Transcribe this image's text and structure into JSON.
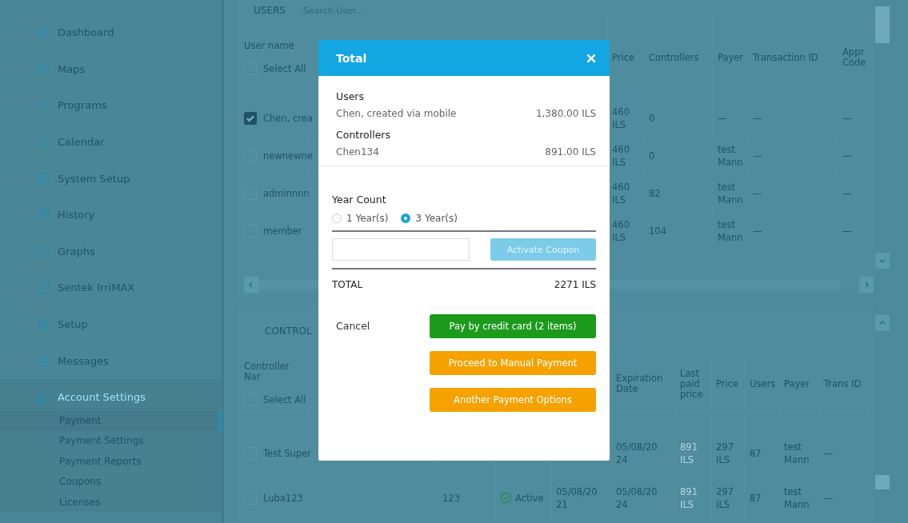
{
  "sidebar": {
    "items": [
      {
        "label": "Dashboard",
        "selected": false
      },
      {
        "label": "Maps",
        "selected": false
      },
      {
        "label": "Programs",
        "selected": false
      },
      {
        "label": "Calendar",
        "selected": false
      },
      {
        "label": "System Setup",
        "selected": false
      },
      {
        "label": "History",
        "selected": false
      },
      {
        "label": "Graphs",
        "selected": false
      },
      {
        "label": "Sentek IrriMAX",
        "selected": false
      },
      {
        "label": "Setup",
        "selected": false
      },
      {
        "label": "Messages",
        "selected": false
      },
      {
        "label": "Account Settings",
        "selected": true,
        "children": [
          {
            "label": "Payment",
            "selected": true
          },
          {
            "label": "Payment Settings",
            "selected": false
          },
          {
            "label": "Payment Reports",
            "selected": false
          },
          {
            "label": "Coupons",
            "selected": false
          },
          {
            "label": "Licenses",
            "selected": false
          }
        ]
      }
    ]
  },
  "users_section": {
    "title": "USERS",
    "search": {
      "placeholder": "Search User..."
    },
    "columns": {
      "name": "User name",
      "price": "Price",
      "controllers": "Controllers",
      "payer": "Payer",
      "transaction_id": "Transaction ID",
      "appr_code": "Appr Code"
    },
    "select_all": {
      "label": "Select All",
      "checked": false
    },
    "rows": [
      {
        "name": "Chen, crea",
        "checked": true,
        "price": "460 ILS",
        "controllers": "0",
        "payer": "—",
        "transaction_id": "—",
        "appr_code": "—"
      },
      {
        "name": "newnewne",
        "checked": false,
        "price": "460 ILS",
        "controllers": "0",
        "payer": "test Mann",
        "transaction_id": "—",
        "appr_code": "—"
      },
      {
        "name": "adminnnn",
        "checked": false,
        "price": "460 ILS",
        "controllers": "82",
        "payer": "test Mann",
        "transaction_id": "—",
        "appr_code": "—"
      },
      {
        "name": "member",
        "checked": false,
        "price": "460 ILS",
        "controllers": "104",
        "payer": "test Mann",
        "transaction_id": "—",
        "appr_code": "—"
      }
    ]
  },
  "controllers_section": {
    "title": "CONTROL",
    "columns": {
      "name": "Controller Nar",
      "expiration": "Expiration Date",
      "last_paid": "Last paid price",
      "price": "Price",
      "users": "Users",
      "payer": "Payer",
      "transaction_id": "Trans ID"
    },
    "select_all": {
      "label": "Select All",
      "checked": false
    },
    "rows": [
      {
        "name": "Test Super",
        "checked": false,
        "expiration": "05/08/2024",
        "last_paid": "891 ILS",
        "price": "297 ILS",
        "users": "87",
        "payer": "test Mann",
        "transaction_id": "—"
      },
      {
        "name": "Luba123",
        "checked": false,
        "column_3": "123",
        "status": "Active",
        "column_5": "05/08/2021",
        "expiration": "05/08/2024",
        "last_paid": "891 ILS",
        "price": "297 ILS",
        "users": "87",
        "payer": "test Mann",
        "transaction_id": "—"
      }
    ]
  },
  "dialog": {
    "title": "Total",
    "groups": [
      {
        "title": "Users",
        "items": [
          {
            "name": "Chen, created via mobile",
            "amount": "1,380.00 ILS"
          }
        ]
      },
      {
        "title": "Controllers",
        "items": [
          {
            "name": "Chen134",
            "amount": "891.00 ILS"
          }
        ]
      }
    ],
    "year_count": {
      "label": "Year Count",
      "options": [
        {
          "label": "1 Year(s)",
          "selected": false
        },
        {
          "label": "3 Year(s)",
          "selected": true
        }
      ]
    },
    "coupon": {
      "button": "Activate Coupon",
      "disabled": true
    },
    "total": {
      "label": "TOTAL",
      "value": "2271 ILS"
    },
    "cancel": "Cancel",
    "actions": [
      {
        "label": "Pay by credit card  (2 items)",
        "kind": "success"
      },
      {
        "label": "Proceed to Manual Payment",
        "kind": "warning"
      },
      {
        "label": "Another Payment Options",
        "kind": "warning"
      }
    ]
  }
}
